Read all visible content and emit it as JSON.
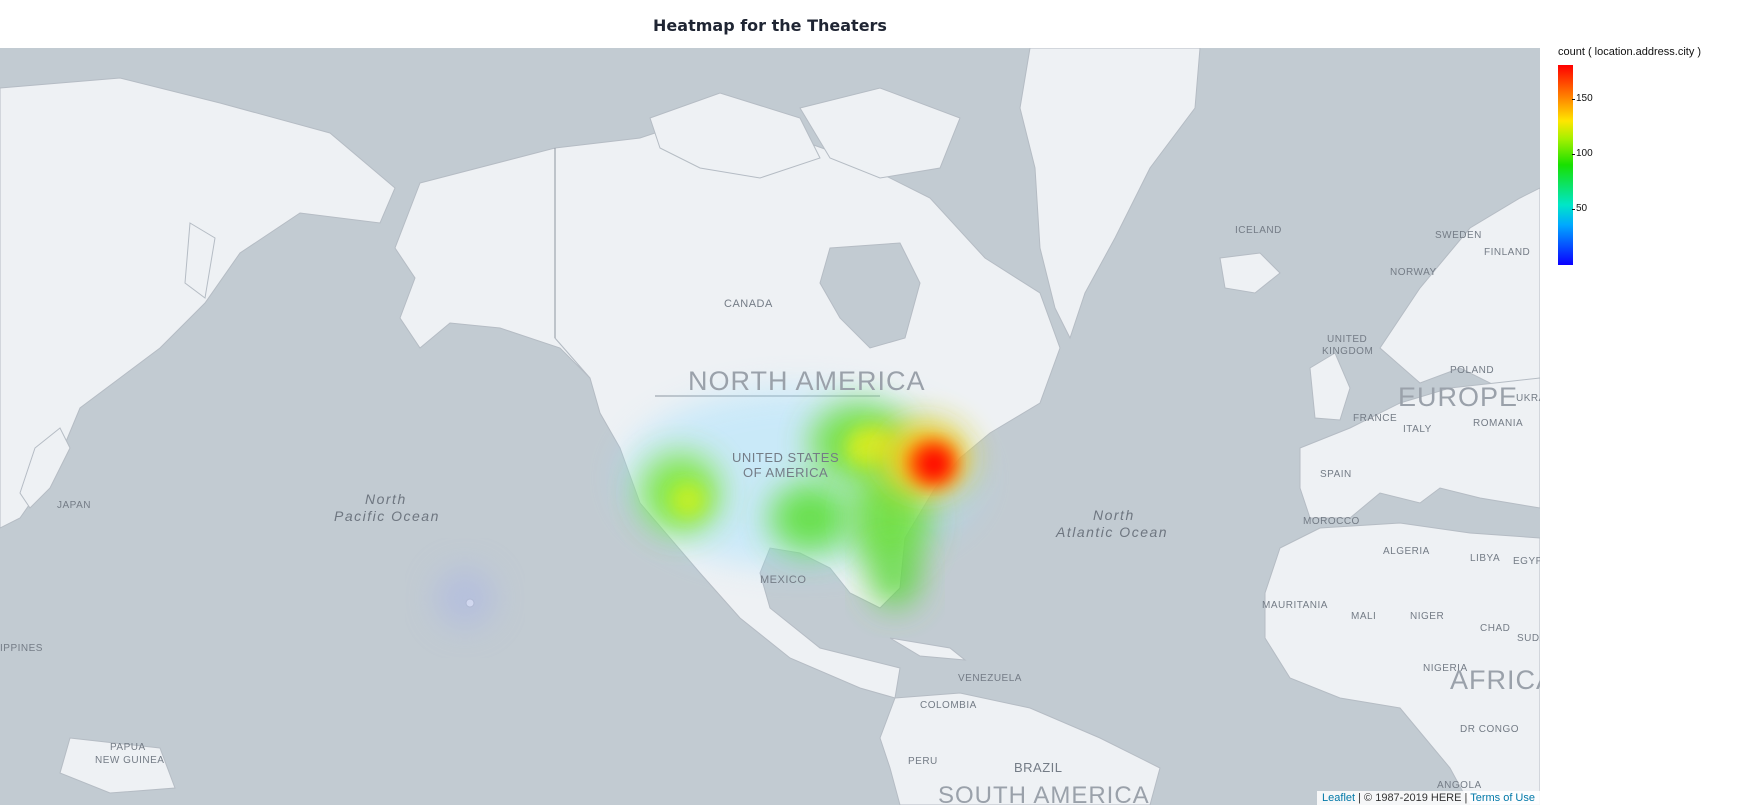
{
  "title": "Heatmap for the Theaters",
  "legend": {
    "title": "count ( location.address.city )",
    "ticks": [
      {
        "label": "150",
        "value": 150
      },
      {
        "label": "100",
        "value": 100
      },
      {
        "label": "50",
        "value": 50
      }
    ],
    "colors": [
      "#0b00ff",
      "#00a8ff",
      "#18e000",
      "#ffe600",
      "#ff7a00",
      "#ff0000"
    ]
  },
  "map": {
    "colors": {
      "water": "#c2cbd2",
      "land": "#eef1f4",
      "border": "#b5bcc4"
    },
    "labels": {
      "canada": "CANADA",
      "north_america": "NORTH AMERICA",
      "usa_1": "UNITED STATES",
      "usa_2": "OF AMERICA",
      "mexico": "MEXICO",
      "north_pacific_1": "North",
      "north_pacific_2": "Pacific Ocean",
      "north_atlantic_1": "North",
      "north_atlantic_2": "Atlantic Ocean",
      "japan": "JAPAN",
      "philippines": "IPPINES",
      "papua_1": "PAPUA",
      "papua_2": "NEW GUINEA",
      "iceland": "ICELAND",
      "sweden": "SWEDEN",
      "finland": "FINLAND",
      "norway": "NORWAY",
      "uk_1": "UNITED",
      "uk_2": "KINGDOM",
      "poland": "POLAND",
      "europe": "EUROPE",
      "ukraine": "UKRA",
      "france": "FRANCE",
      "italy": "ITALY",
      "romania": "ROMANIA",
      "spain": "SPAIN",
      "morocco": "MOROCCO",
      "algeria": "ALGERIA",
      "libya": "LIBYA",
      "egypt": "EGYPT",
      "mauritania": "MAURITANIA",
      "mali": "MALI",
      "niger": "NIGER",
      "chad": "CHAD",
      "sudan": "SUDA",
      "nigeria": "NIGERIA",
      "africa": "AFRICA",
      "dr_congo": "DR CONGO",
      "angola": "ANGOLA",
      "venezuela": "VENEZUELA",
      "colombia": "COLOMBIA",
      "peru": "PERU",
      "brazil": "BRAZIL",
      "south_america": "SOUTH AMERICA"
    }
  },
  "attribution": {
    "leaflet": "Leaflet",
    "text": " | © 1987-2019 HERE | ",
    "terms": "Terms of Use"
  }
}
